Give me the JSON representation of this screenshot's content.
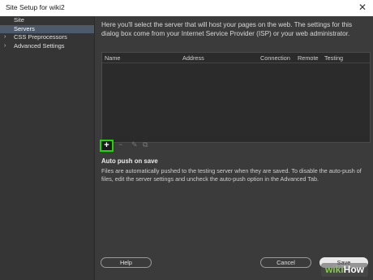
{
  "window": {
    "title": "Site Setup for wiki2",
    "close_glyph": "✕"
  },
  "sidebar": {
    "items": [
      {
        "label": "Site",
        "chevron": ""
      },
      {
        "label": "Servers",
        "chevron": ""
      },
      {
        "label": "CSS Preprocessors",
        "chevron": "›"
      },
      {
        "label": "Advanced Settings",
        "chevron": "›"
      }
    ],
    "selected_index": 1
  },
  "main": {
    "intro": "Here you'll select the server that will host your pages on the web. The settings for this dialog box come from your Internet Service Provider (ISP) or your web administrator.",
    "table": {
      "columns": [
        "Name",
        "Address",
        "Connection",
        "Remote",
        "Testing"
      ],
      "rows": []
    },
    "toolbar": {
      "add_label": "+",
      "remove_label": "−",
      "edit_icon": "✎",
      "duplicate_icon": "⧉"
    },
    "auto_push": {
      "title": "Auto push on save",
      "description": "Files are automatically pushed to the testing server when they are saved. To disable the auto-push of files, edit the server settings and uncheck the auto-push option in the Advanced Tab."
    }
  },
  "footer": {
    "help_label": "Help",
    "cancel_label": "Cancel",
    "save_label": "Save"
  },
  "watermark": {
    "part1": "wiki",
    "part2": "How"
  },
  "colors": {
    "highlight": "#1fd800",
    "selected": "#4d5a6b",
    "panel": "#3b3b3b"
  }
}
